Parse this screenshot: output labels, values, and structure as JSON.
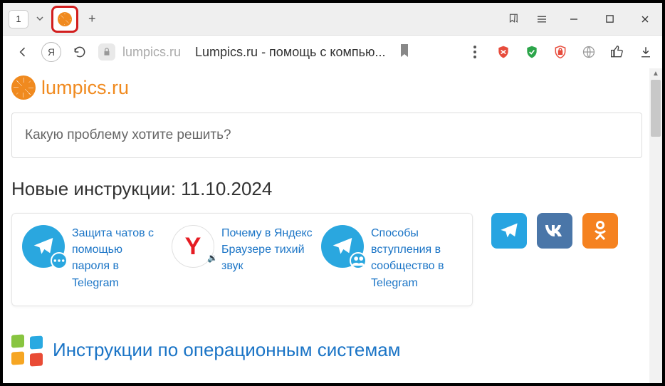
{
  "titlebar": {
    "tab_count": "1"
  },
  "addressbar": {
    "yandex_label": "Я",
    "host": "lumpics.ru",
    "title": "Lumpics.ru - помощь с компью..."
  },
  "page": {
    "logo_text": "lumpics.ru",
    "search_placeholder": "Какую проблему хотите решить?",
    "section_title": "Новые инструкции: 11.10.2024",
    "cards": [
      {
        "title": "Защита чатов с помощью пароля в Telegram"
      },
      {
        "title": "Почему в Яндекс Браузере тихий звук"
      },
      {
        "title": "Способы вступления в сообщество в Telegram"
      }
    ],
    "section2_title": "Инструкции по операционным системам"
  }
}
